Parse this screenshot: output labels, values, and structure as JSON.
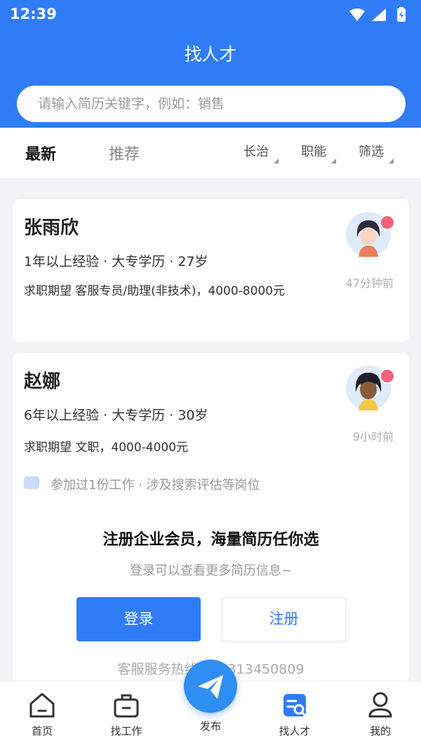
{
  "status": {
    "time": "12:39"
  },
  "header": {
    "title": "找人才"
  },
  "search": {
    "placeholder": "请输入简历关键字，例如：销售"
  },
  "tabs": {
    "latest": "最新",
    "recommend": "推荐"
  },
  "filters": {
    "city": "长治",
    "position": "职能",
    "screen": "筛选"
  },
  "candidates": [
    {
      "name": "张雨欣",
      "meta": "1年以上经验 · 大专学历 · 27岁",
      "expectation": "求职期望 客服专员/助理(非技术)，4000-8000元",
      "time_ago": "47分钟前"
    },
    {
      "name": "赵娜",
      "meta": "6年以上经验 · 大专学历 · 30岁",
      "expectation": "求职期望 文职，4000-4000元",
      "time_ago": "9小时前",
      "history": "参加过1份工作 · 涉及搜索评估等岗位"
    }
  ],
  "promo": {
    "title": "注册企业会员，海量简历任你选",
    "subtitle": "登录可以查看更多简历信息~",
    "login": "登录",
    "register": "注册",
    "hotline": "客服服务热线：13313450809"
  },
  "nav": {
    "home": "首页",
    "jobs": "找工作",
    "publish": "发布",
    "talent": "找人才",
    "mine": "我的"
  },
  "colors": {
    "primary": "#2f7cf6",
    "badge": "#f0627a"
  }
}
